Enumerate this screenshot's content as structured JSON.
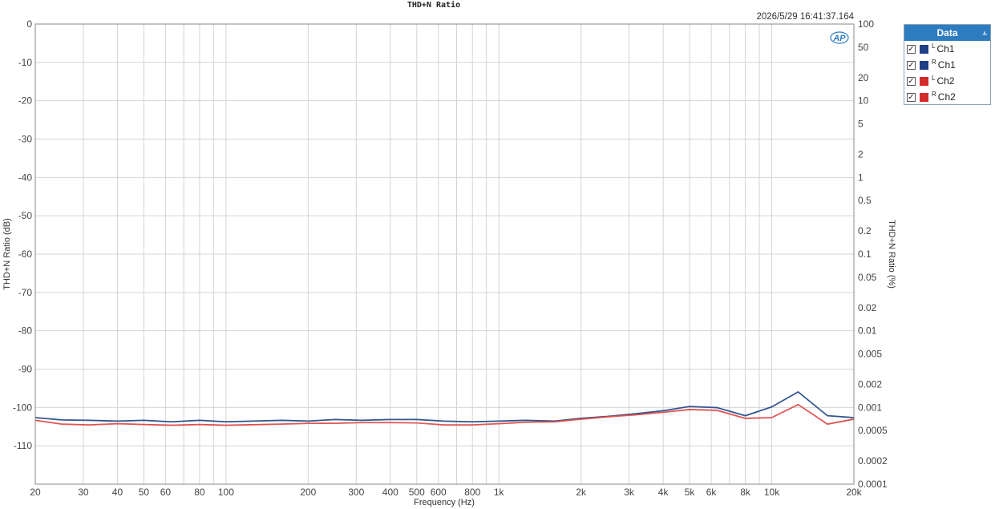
{
  "chart_data": {
    "type": "line",
    "title": "THD+N Ratio",
    "timestamp": "2026/5/29 16:41:37.164",
    "logo_text": "AP",
    "xlabel": "Frequency (Hz)",
    "ylabel_left": "THD+N Ratio (dB)",
    "ylabel_right": "THD+N Ratio (%)",
    "x_scale": "log",
    "xlim": [
      20,
      20000
    ],
    "ylim": [
      -120,
      0
    ],
    "grid": true,
    "x_ticks": [
      {
        "value": 20,
        "label": "20"
      },
      {
        "value": 30,
        "label": "30"
      },
      {
        "value": 40,
        "label": "40"
      },
      {
        "value": 50,
        "label": "50"
      },
      {
        "value": 60,
        "label": "60"
      },
      {
        "value": 80,
        "label": "80"
      },
      {
        "value": 100,
        "label": "100"
      },
      {
        "value": 200,
        "label": "200"
      },
      {
        "value": 300,
        "label": "300"
      },
      {
        "value": 400,
        "label": "400"
      },
      {
        "value": 500,
        "label": "500"
      },
      {
        "value": 600,
        "label": "600"
      },
      {
        "value": 800,
        "label": "800"
      },
      {
        "value": 1000,
        "label": "1k"
      },
      {
        "value": 2000,
        "label": "2k"
      },
      {
        "value": 3000,
        "label": "3k"
      },
      {
        "value": 4000,
        "label": "4k"
      },
      {
        "value": 5000,
        "label": "5k"
      },
      {
        "value": 6000,
        "label": "6k"
      },
      {
        "value": 8000,
        "label": "8k"
      },
      {
        "value": 10000,
        "label": "10k"
      },
      {
        "value": 20000,
        "label": "20k"
      }
    ],
    "x_minor_grid": [
      70,
      90,
      700,
      900,
      7000,
      9000
    ],
    "y_ticks_left": [
      0,
      -10,
      -20,
      -30,
      -40,
      -50,
      -60,
      -70,
      -80,
      -90,
      -100,
      -110
    ],
    "y_ticks_right": [
      "100",
      "50",
      "20",
      "10",
      "5",
      "2",
      "1",
      "0.5",
      "0.2",
      "0.1",
      "0.05",
      "0.02",
      "0.01",
      "0.005",
      "0.002",
      "0.001",
      "0.0005",
      "0.0002",
      "0.0001"
    ],
    "x": [
      20,
      25,
      31.5,
      40,
      50,
      63,
      80,
      100,
      160,
      200,
      250,
      315,
      400,
      500,
      630,
      800,
      1000,
      1250,
      1600,
      2000,
      2500,
      3150,
      4000,
      5000,
      6300,
      8000,
      10000,
      12500,
      16000,
      20000
    ],
    "series": [
      {
        "name": "Ch1",
        "channel": "L",
        "color": "#2a4a8a",
        "values": [
          -102.6,
          -103.2,
          -103.3,
          -103.5,
          -103.3,
          -103.7,
          -103.3,
          -103.7,
          -103.3,
          -103.5,
          -103.1,
          -103.3,
          -103.1,
          -103.1,
          -103.5,
          -103.7,
          -103.5,
          -103.3,
          -103.5,
          -102.8,
          -102.3,
          -101.6,
          -100.8,
          -99.7,
          -100.0,
          -102.1,
          -99.8,
          -95.9,
          -102.1,
          -102.6
        ]
      },
      {
        "name": "Ch1",
        "channel": "R",
        "color": "#33578f",
        "values": [
          -102.7,
          -103.3,
          -103.4,
          -103.6,
          -103.4,
          -103.8,
          -103.4,
          -103.8,
          -103.4,
          -103.6,
          -103.2,
          -103.4,
          -103.2,
          -103.2,
          -103.6,
          -103.8,
          -103.6,
          -103.4,
          -103.6,
          -102.9,
          -102.4,
          -101.7,
          -100.9,
          -99.8,
          -100.1,
          -102.2,
          -99.9,
          -96.0,
          -102.2,
          -102.7
        ]
      },
      {
        "name": "Ch2",
        "channel": "L",
        "color": "#d9403f",
        "values": [
          -103.3,
          -104.3,
          -104.5,
          -104.2,
          -104.4,
          -104.6,
          -104.4,
          -104.6,
          -104.3,
          -104.1,
          -104.1,
          -103.9,
          -103.9,
          -104.0,
          -104.5,
          -104.5,
          -104.2,
          -103.8,
          -103.7,
          -103.0,
          -102.4,
          -101.9,
          -101.2,
          -100.5,
          -100.7,
          -102.8,
          -102.6,
          -99.2,
          -104.3,
          -103.0
        ]
      },
      {
        "name": "Ch2",
        "channel": "R",
        "color": "#e05a58",
        "values": [
          -103.4,
          -104.4,
          -104.6,
          -104.3,
          -104.5,
          -104.7,
          -104.5,
          -104.7,
          -104.4,
          -104.2,
          -104.2,
          -104.0,
          -104.0,
          -104.1,
          -104.6,
          -104.6,
          -104.3,
          -103.9,
          -103.8,
          -103.1,
          -102.5,
          -102.0,
          -101.3,
          -100.6,
          -100.8,
          -102.9,
          -102.7,
          -99.3,
          -104.4,
          -103.1
        ]
      }
    ]
  },
  "legend": {
    "header": "Data",
    "pin_icon": "pin-icon",
    "items": [
      {
        "sup": "L",
        "label": "Ch1",
        "color": "#1f3f86",
        "checked": true
      },
      {
        "sup": "R",
        "label": "Ch1",
        "color": "#1f3f86",
        "checked": true
      },
      {
        "sup": "L",
        "label": "Ch2",
        "color": "#d42a2a",
        "checked": true
      },
      {
        "sup": "R",
        "label": "Ch2",
        "color": "#d42a2a",
        "checked": true
      }
    ]
  }
}
